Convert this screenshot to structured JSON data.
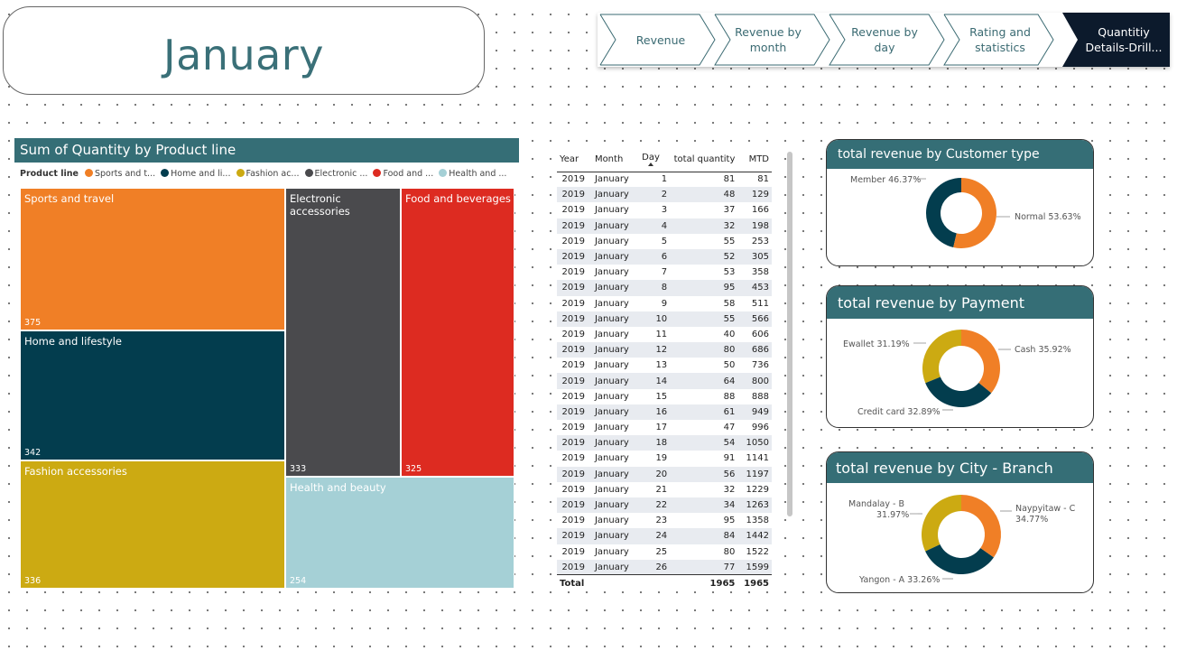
{
  "page_title": "January",
  "nav": {
    "buttons": [
      {
        "label": "Revenue"
      },
      {
        "label": "Revenue by month"
      },
      {
        "label": "Revenue by day"
      },
      {
        "label": "Rating and statistics"
      },
      {
        "label": "Quantitiy Details-Drill..."
      }
    ],
    "active_index": 4
  },
  "treemap": {
    "title": "Sum of Quantity by Product line",
    "legend_title": "Product line",
    "legend": [
      {
        "label": "Sports and t...",
        "color": "#f07f26"
      },
      {
        "label": "Home and li...",
        "color": "#033d4e"
      },
      {
        "label": "Fashion ac...",
        "color": "#ccaa12"
      },
      {
        "label": "Electronic ...",
        "color": "#4a4a4d"
      },
      {
        "label": "Food and ...",
        "color": "#dd2b21"
      },
      {
        "label": "Health and ...",
        "color": "#a5d0d6"
      }
    ],
    "tiles": [
      {
        "name": "Sports and travel",
        "value": "375",
        "color": "#f07f26"
      },
      {
        "name": "Home and lifestyle",
        "value": "342",
        "color": "#033d4e"
      },
      {
        "name": "Fashion accessories",
        "value": "336",
        "color": "#ccaa12"
      },
      {
        "name": "Electronic accessories",
        "value": "333",
        "color": "#4a4a4d"
      },
      {
        "name": "Food and beverages",
        "value": "325",
        "color": "#dd2b21"
      },
      {
        "name": "Health and beauty",
        "value": "254",
        "color": "#a5d0d6"
      }
    ]
  },
  "table": {
    "headers": {
      "year": "Year",
      "month": "Month",
      "day": "Day",
      "qty": "total quantity",
      "mtd": "MTD"
    },
    "rows": [
      [
        "2019",
        "January",
        "1",
        "81",
        "81"
      ],
      [
        "2019",
        "January",
        "2",
        "48",
        "129"
      ],
      [
        "2019",
        "January",
        "3",
        "37",
        "166"
      ],
      [
        "2019",
        "January",
        "4",
        "32",
        "198"
      ],
      [
        "2019",
        "January",
        "5",
        "55",
        "253"
      ],
      [
        "2019",
        "January",
        "6",
        "52",
        "305"
      ],
      [
        "2019",
        "January",
        "7",
        "53",
        "358"
      ],
      [
        "2019",
        "January",
        "8",
        "95",
        "453"
      ],
      [
        "2019",
        "January",
        "9",
        "58",
        "511"
      ],
      [
        "2019",
        "January",
        "10",
        "55",
        "566"
      ],
      [
        "2019",
        "January",
        "11",
        "40",
        "606"
      ],
      [
        "2019",
        "January",
        "12",
        "80",
        "686"
      ],
      [
        "2019",
        "January",
        "13",
        "50",
        "736"
      ],
      [
        "2019",
        "January",
        "14",
        "64",
        "800"
      ],
      [
        "2019",
        "January",
        "15",
        "88",
        "888"
      ],
      [
        "2019",
        "January",
        "16",
        "61",
        "949"
      ],
      [
        "2019",
        "January",
        "17",
        "47",
        "996"
      ],
      [
        "2019",
        "January",
        "18",
        "54",
        "1050"
      ],
      [
        "2019",
        "January",
        "19",
        "91",
        "1141"
      ],
      [
        "2019",
        "January",
        "20",
        "56",
        "1197"
      ],
      [
        "2019",
        "January",
        "21",
        "32",
        "1229"
      ],
      [
        "2019",
        "January",
        "22",
        "34",
        "1263"
      ],
      [
        "2019",
        "January",
        "23",
        "95",
        "1358"
      ],
      [
        "2019",
        "January",
        "24",
        "84",
        "1442"
      ],
      [
        "2019",
        "January",
        "25",
        "80",
        "1522"
      ],
      [
        "2019",
        "January",
        "26",
        "77",
        "1599"
      ]
    ],
    "total": {
      "label": "Total",
      "qty": "1965",
      "mtd": "1965"
    }
  },
  "customer_type": {
    "title": "total revenue by Customer type",
    "slices": [
      {
        "label": "Normal 53.63%",
        "value": 53.63,
        "color": "#f07f26"
      },
      {
        "label": "Member 46.37%",
        "value": 46.37,
        "color": "#033d4e"
      }
    ]
  },
  "payment": {
    "title": "total revenue by Payment",
    "slices": [
      {
        "label": "Cash 35.92%",
        "value": 35.92,
        "color": "#f07f26"
      },
      {
        "label": "Credit card 32.89%",
        "value": 32.89,
        "color": "#033d4e"
      },
      {
        "label": "Ewallet 31.19%",
        "value": 31.19,
        "color": "#ccaa12"
      }
    ]
  },
  "city_branch": {
    "title": "total revenue by City - Branch",
    "slices": [
      {
        "label_line1": "Naypyitaw - C",
        "label_line2": "34.77%",
        "value": 34.77,
        "color": "#f07f26"
      },
      {
        "label_line1": "Yangon - A 33.26%",
        "label_line2": "",
        "value": 33.26,
        "color": "#033d4e"
      },
      {
        "label_line1": "Mandalay - B",
        "label_line2": "31.97%",
        "value": 31.97,
        "color": "#ccaa12"
      }
    ]
  }
}
